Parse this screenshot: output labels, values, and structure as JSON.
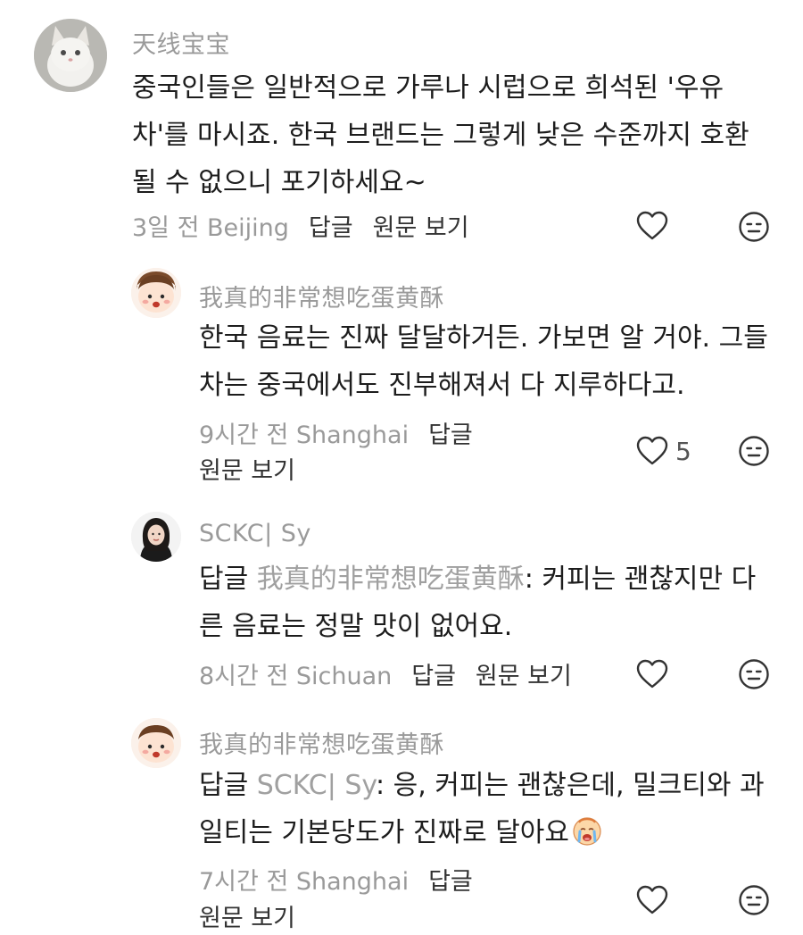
{
  "comments": [
    {
      "username": "天线宝宝",
      "lines": [
        "중국인들은 일반적으로 가루나 시럽으로 희석된 '우유",
        "차'를 마시죠. 한국 브랜드는 그렇게 낮은 수준까지 호환",
        "될 수 없으니 포기하세요~"
      ],
      "time_location": "3일 전 Beijing",
      "reply_label": "답글",
      "view_original_label": "원문 보기",
      "like_count": ""
    },
    {
      "username": "我真的非常想吃蛋黄酥",
      "lines": [
        "한국 음료는 진짜 달달하거든. 가보면 알 거야. 그들",
        "차는 중국에서도 진부해져서 다 지루하다고."
      ],
      "time_location": "9시간 전 Shanghai",
      "reply_label": "답글",
      "view_original_label": "원문 보기",
      "like_count": "5"
    },
    {
      "username": "SCKC| Sy",
      "reply_prefix": "답글",
      "reply_target": "我真的非常想吃蛋黄酥",
      "line1_rest": ": 커피는 괜찮지만 다",
      "line2": "른 음료는 정말 맛이 없어요.",
      "time_location": "8시간 전 Sichuan",
      "reply_label": "답글",
      "view_original_label": "원문 보기",
      "like_count": ""
    },
    {
      "username": "我真的非常想吃蛋黄酥",
      "reply_prefix": "답글",
      "reply_target": "SCKC| Sy",
      "line1_rest": ": 응, 커피는 괜찮은데, 밀크티와 과",
      "line2": "일티는 기본당도가 진짜로 달아요",
      "time_location": "7시간 전 Shanghai",
      "reply_label": "답글",
      "view_original_label": "원문 보기",
      "like_count": ""
    }
  ],
  "icons": {
    "like": "heart-outline-icon",
    "dislike": "neutral-face-icon",
    "inline_emoji": "crying-face-emoji"
  },
  "colors": {
    "username": "#9a9a9a",
    "meta": "#9a9a9a",
    "action": "#333333",
    "body": "#1d1d1d"
  }
}
